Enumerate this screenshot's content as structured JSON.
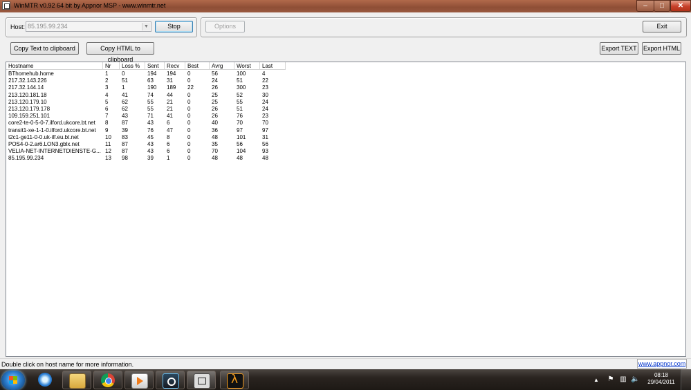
{
  "window": {
    "title": "WinMTR v0.92 64 bit by Appnor MSP - www.winmtr.net",
    "minimize": "–",
    "maximize": "□",
    "close": "✕"
  },
  "toolbar": {
    "host_label": "Host:",
    "host_value": "85.195.99.234",
    "stop_label": "Stop",
    "options_label": "Options",
    "exit_label": "Exit",
    "copy_text_label": "Copy Text to clipboard",
    "copy_html_label": "Copy HTML to clipboard",
    "export_text_label": "Export TEXT",
    "export_html_label": "Export HTML"
  },
  "table": {
    "columns": [
      "Hostname",
      "Nr",
      "Loss %",
      "Sent",
      "Recv",
      "Best",
      "Avrg",
      "Worst",
      "Last"
    ],
    "rows": [
      [
        "BThomehub.home",
        "1",
        "0",
        "194",
        "194",
        "0",
        "56",
        "100",
        "4"
      ],
      [
        "217.32.143.226",
        "2",
        "51",
        "63",
        "31",
        "0",
        "24",
        "51",
        "22"
      ],
      [
        "217.32.144.14",
        "3",
        "1",
        "190",
        "189",
        "22",
        "26",
        "300",
        "23"
      ],
      [
        "213.120.181.18",
        "4",
        "41",
        "74",
        "44",
        "0",
        "25",
        "52",
        "30"
      ],
      [
        "213.120.179.10",
        "5",
        "62",
        "55",
        "21",
        "0",
        "25",
        "55",
        "24"
      ],
      [
        "213.120.179.178",
        "6",
        "62",
        "55",
        "21",
        "0",
        "26",
        "51",
        "24"
      ],
      [
        "109.159.251.101",
        "7",
        "43",
        "71",
        "41",
        "0",
        "26",
        "76",
        "23"
      ],
      [
        "core2-te-0-5-0-7.ilford.ukcore.bt.net",
        "8",
        "87",
        "43",
        "6",
        "0",
        "40",
        "70",
        "70"
      ],
      [
        "transit1-xe-1-1-0.ilford.ukcore.bt.net",
        "9",
        "39",
        "76",
        "47",
        "0",
        "36",
        "97",
        "97"
      ],
      [
        "t2c1-ge11-0-0.uk-ilf.eu.bt.net",
        "10",
        "83",
        "45",
        "8",
        "0",
        "48",
        "101",
        "31"
      ],
      [
        "POS4-0-2.ar6.LON3.gblx.net",
        "11",
        "87",
        "43",
        "6",
        "0",
        "35",
        "56",
        "56"
      ],
      [
        "VELIA-NET-INTERNETDIENSTE-G...",
        "12",
        "87",
        "43",
        "6",
        "0",
        "70",
        "104",
        "93"
      ],
      [
        "85.195.99.234",
        "13",
        "98",
        "39",
        "1",
        "0",
        "48",
        "48",
        "48"
      ]
    ]
  },
  "statusbar": {
    "text": "Double click on host name for more information.",
    "link": "www.appnor.com"
  },
  "taskbar": {
    "tray": {
      "show_hidden": "▲",
      "clock_time": "08:18",
      "clock_date": "29/04/2011"
    }
  }
}
